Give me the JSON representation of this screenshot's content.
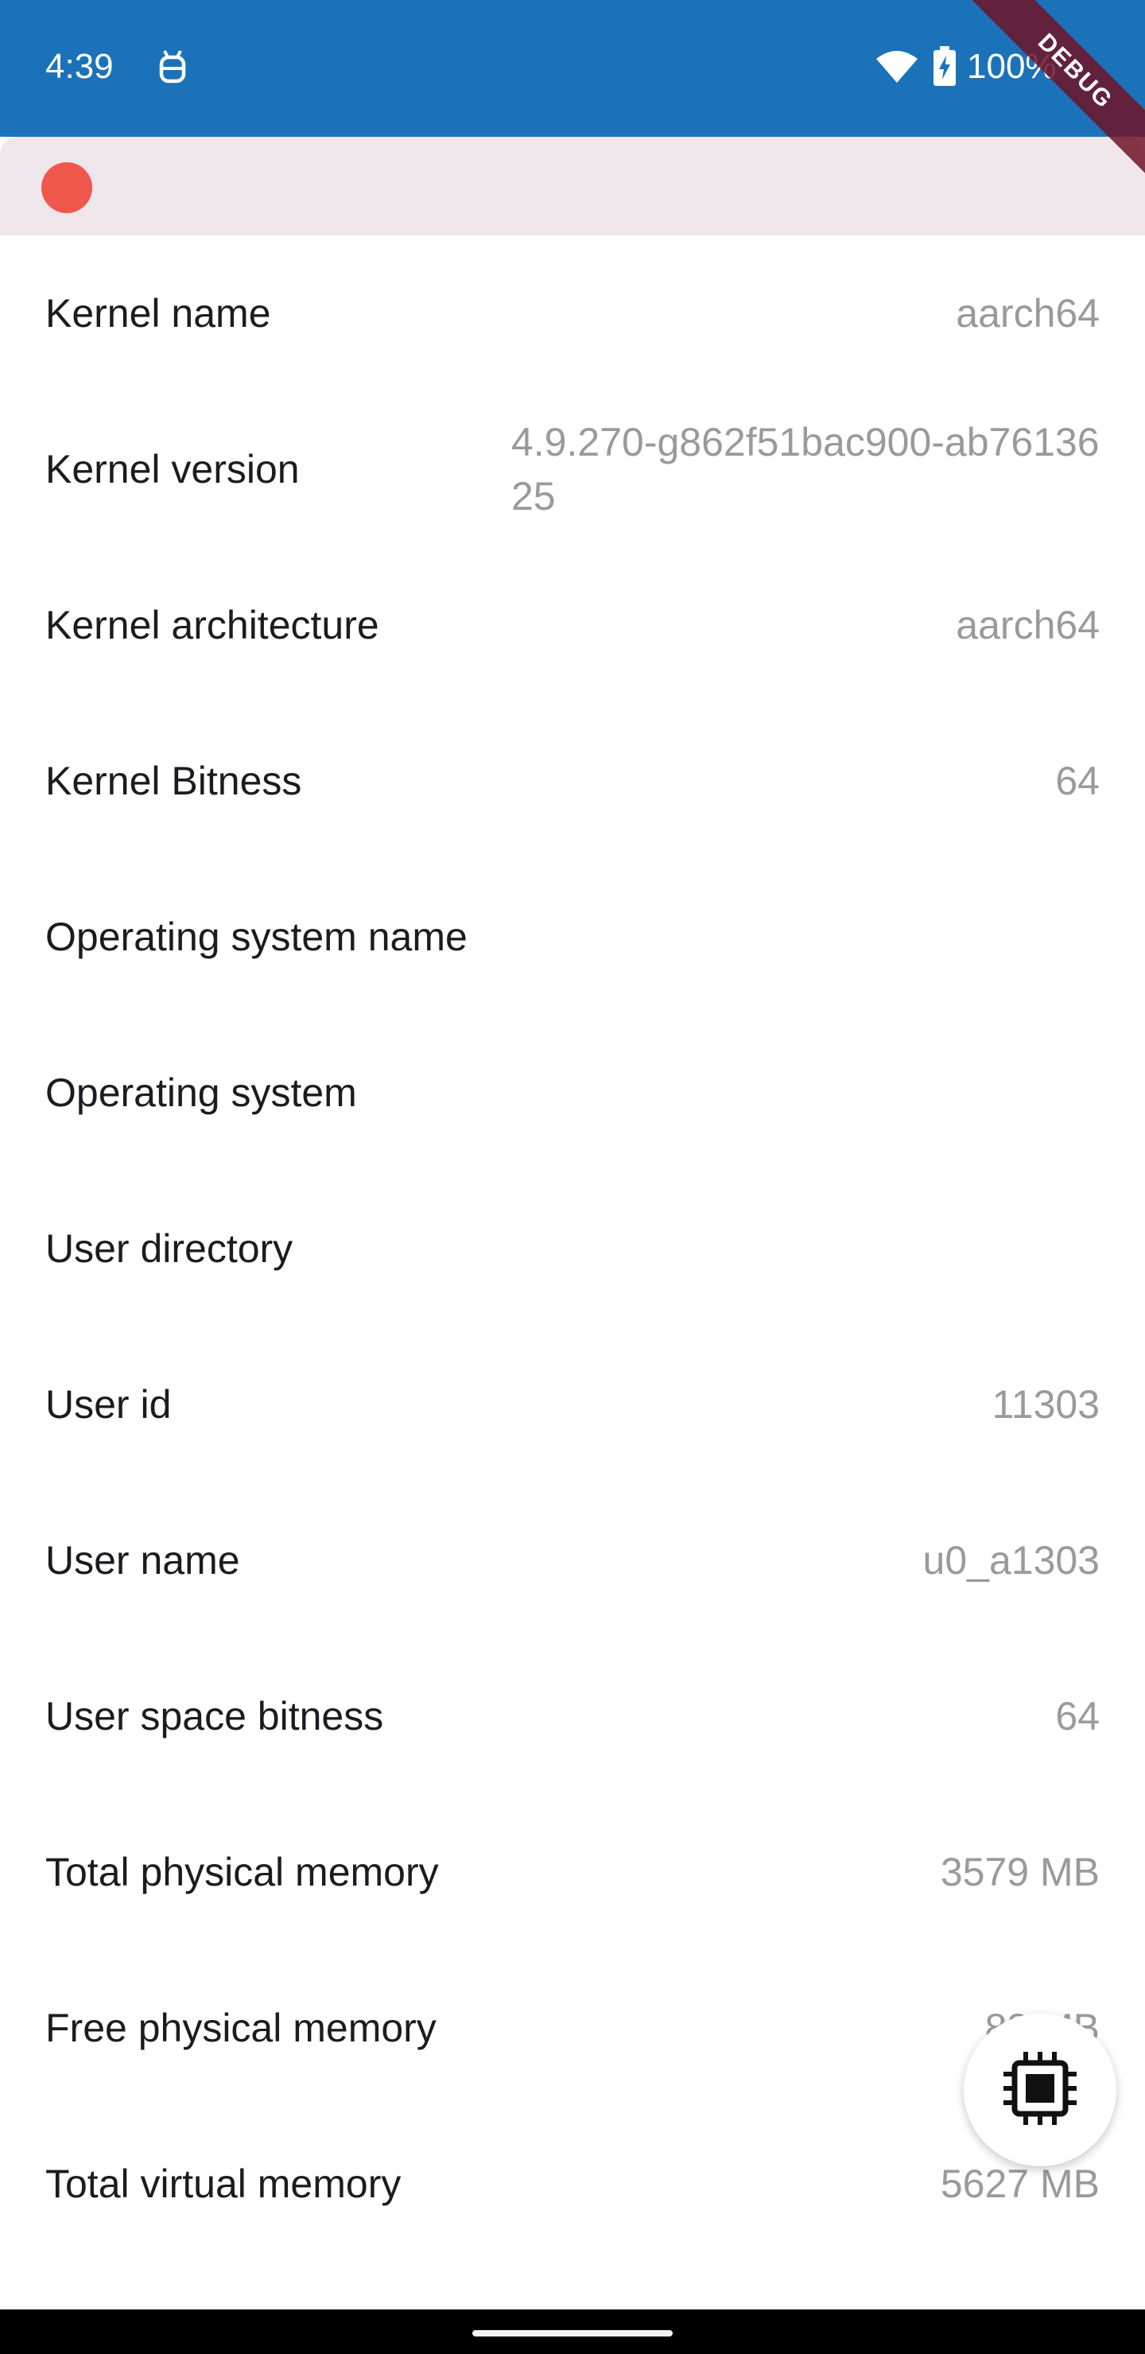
{
  "status_bar": {
    "time": "4:39",
    "battery": "100%",
    "notification_icon": "android-debug-icon",
    "wifi_icon": "wifi-icon",
    "battery_icon": "battery-charging-icon",
    "background_color": "#1b72b8"
  },
  "debug_banner": {
    "label": "DEBUG",
    "color": "#6e1428"
  },
  "top_bar": {
    "record_indicator_color": "#f0574d",
    "background_color": "#efe7ec"
  },
  "rows": [
    {
      "label": "Kernel name",
      "value": "aarch64"
    },
    {
      "label": "Kernel version",
      "value": "4.9.270-g862f51bac900-ab7613625"
    },
    {
      "label": "Kernel architecture",
      "value": "aarch64"
    },
    {
      "label": "Kernel Bitness",
      "value": "64"
    },
    {
      "label": "Operating system name",
      "value": ""
    },
    {
      "label": "Operating system",
      "value": ""
    },
    {
      "label": "User directory",
      "value": ""
    },
    {
      "label": "User id",
      "value": "11303"
    },
    {
      "label": "User name",
      "value": "u0_a1303"
    },
    {
      "label": "User space bitness",
      "value": "64"
    },
    {
      "label": "Total physical memory",
      "value": "3579 MB"
    },
    {
      "label": "Free physical memory",
      "value": "88 MB"
    },
    {
      "label": "Total virtual memory",
      "value": "5627 MB"
    }
  ],
  "fab": {
    "icon": "memory-chip-icon"
  }
}
